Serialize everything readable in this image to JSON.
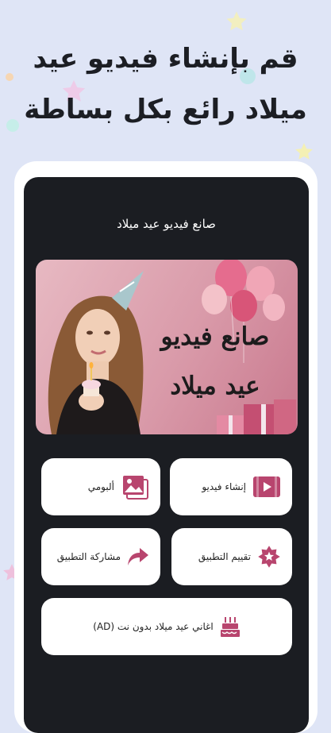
{
  "headline": {
    "line1": "قم بإنشاء فيديو عيد",
    "line2": "ميلاد رائع بكل بساطة"
  },
  "app": {
    "title": "صانع فيديو عيد ميلاد",
    "banner": {
      "line1": "صانع فيديو",
      "line2": "عيد ميلاد"
    },
    "menu": {
      "create_video": "إنشاء فيديو",
      "my_album": "ألبومي",
      "rate_app": "تقييم التطبيق",
      "share_app": "مشاركة التطبيق",
      "birthday_songs": "اغاني عيد ميلاد بدون نت (AD)"
    }
  },
  "colors": {
    "background": "#dfe5f6",
    "screen": "#1b1d22",
    "accent": "#b8456e",
    "card": "#ffffff"
  },
  "icons": {
    "create_video": "video-icon",
    "my_album": "gallery-icon",
    "rate_app": "star-badge-icon",
    "share_app": "share-arrow-icon",
    "birthday_songs": "birthday-cake-icon"
  }
}
